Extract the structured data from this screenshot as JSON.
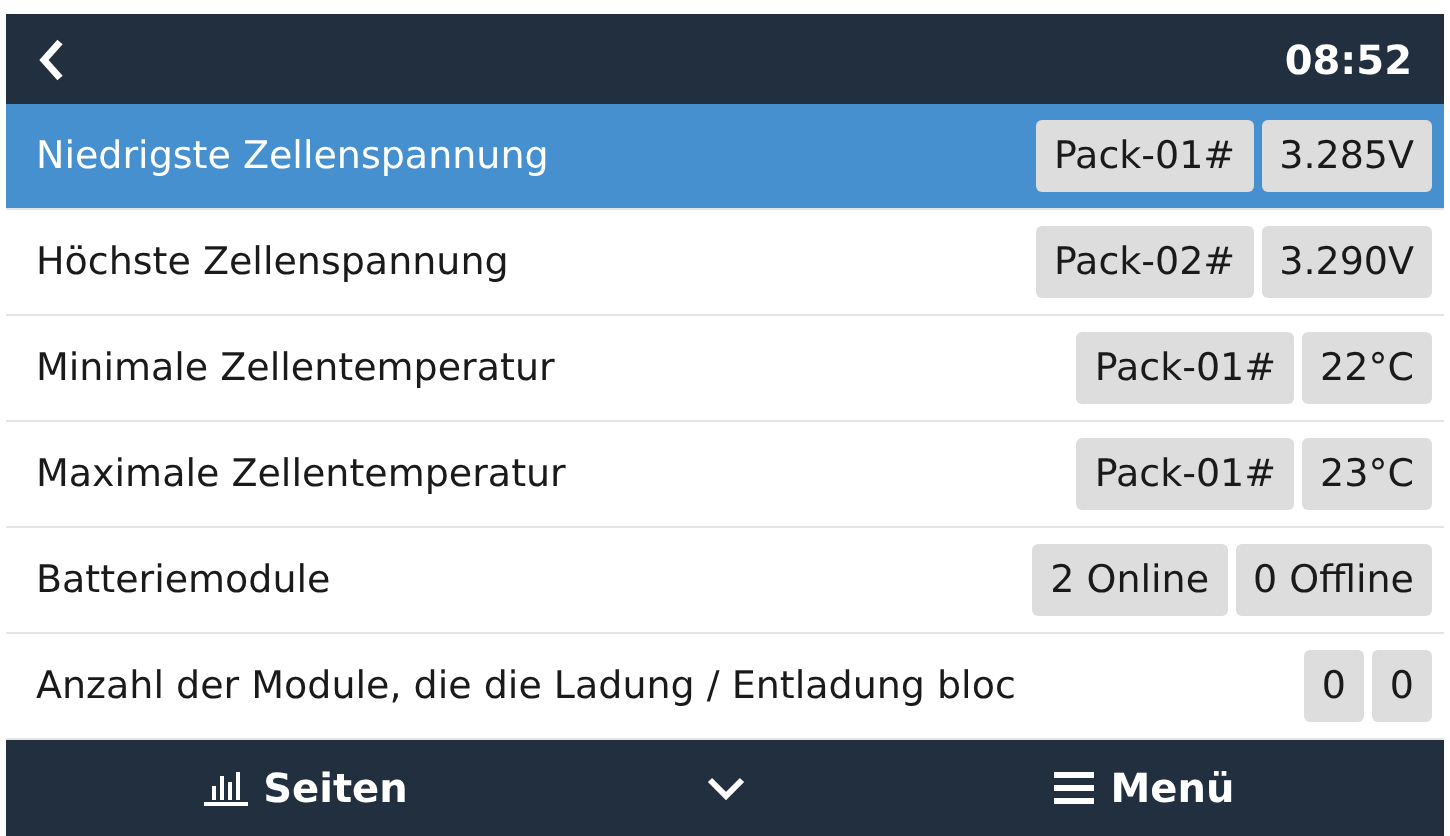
{
  "header": {
    "time": "08:52"
  },
  "rows": [
    {
      "label": "Niedrigste Zellenspannung",
      "selected": true,
      "values": [
        "Pack-01#",
        "3.285V"
      ]
    },
    {
      "label": "Höchste Zellenspannung",
      "selected": false,
      "values": [
        "Pack-02#",
        "3.290V"
      ]
    },
    {
      "label": "Minimale Zellentemperatur",
      "selected": false,
      "values": [
        "Pack-01#",
        "22°C"
      ]
    },
    {
      "label": "Maximale Zellentemperatur",
      "selected": false,
      "values": [
        "Pack-01#",
        "23°C"
      ]
    },
    {
      "label": "Batteriemodule",
      "selected": false,
      "values": [
        "2 Online",
        "0 Offline"
      ]
    },
    {
      "label": "Anzahl der Module, die die Ladung / Entladung bloc",
      "selected": false,
      "values": [
        "0",
        "0"
      ]
    }
  ],
  "footer": {
    "pages": "Seiten",
    "menu": "Menü"
  }
}
